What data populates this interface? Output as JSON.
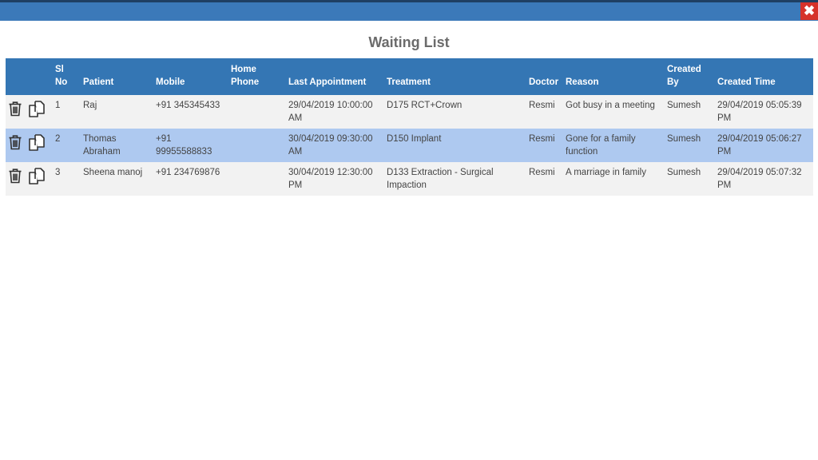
{
  "window": {
    "title": "Waiting List",
    "close_icon": "close-icon"
  },
  "table": {
    "headers": {
      "sl_no": "Sl No",
      "patient": "Patient",
      "mobile": "Mobile",
      "home_phone": "Home Phone",
      "last_appointment": "Last Appointment",
      "treatment": "Treatment",
      "doctor": "Doctor",
      "reason": "Reason",
      "created_by": "Created By",
      "created_time": "Created Time"
    },
    "rows": [
      {
        "sl_no": "1",
        "patient": "Raj",
        "mobile": "+91 345345433",
        "home_phone": "",
        "last_appointment": "29/04/2019 10:00:00 AM",
        "treatment": "D175 RCT+Crown",
        "doctor": "Resmi",
        "reason": "Got busy in a meeting",
        "created_by": "Sumesh",
        "created_time": "29/04/2019 05:05:39 PM"
      },
      {
        "sl_no": "2",
        "patient": "Thomas Abraham",
        "mobile": "+91 99955588833",
        "home_phone": "",
        "last_appointment": "30/04/2019 09:30:00 AM",
        "treatment": "D150 Implant",
        "doctor": "Resmi",
        "reason": "Gone for a family function",
        "created_by": "Sumesh",
        "created_time": "29/04/2019 05:06:27 PM"
      },
      {
        "sl_no": "3",
        "patient": "Sheena manoj",
        "mobile": "+91 234769876",
        "home_phone": "",
        "last_appointment": "30/04/2019 12:30:00 PM",
        "treatment": "D133 Extraction - Surgical Impaction",
        "doctor": "Resmi",
        "reason": "A marriage in family",
        "created_by": "Sumesh",
        "created_time": "29/04/2019 05:07:32 PM"
      }
    ],
    "row_icons": [
      "trash-icon",
      "copy-icon"
    ]
  },
  "colors": {
    "header_bg": "#3476b4",
    "selected_row": "#aec9f0",
    "close_button": "#d6322a"
  }
}
